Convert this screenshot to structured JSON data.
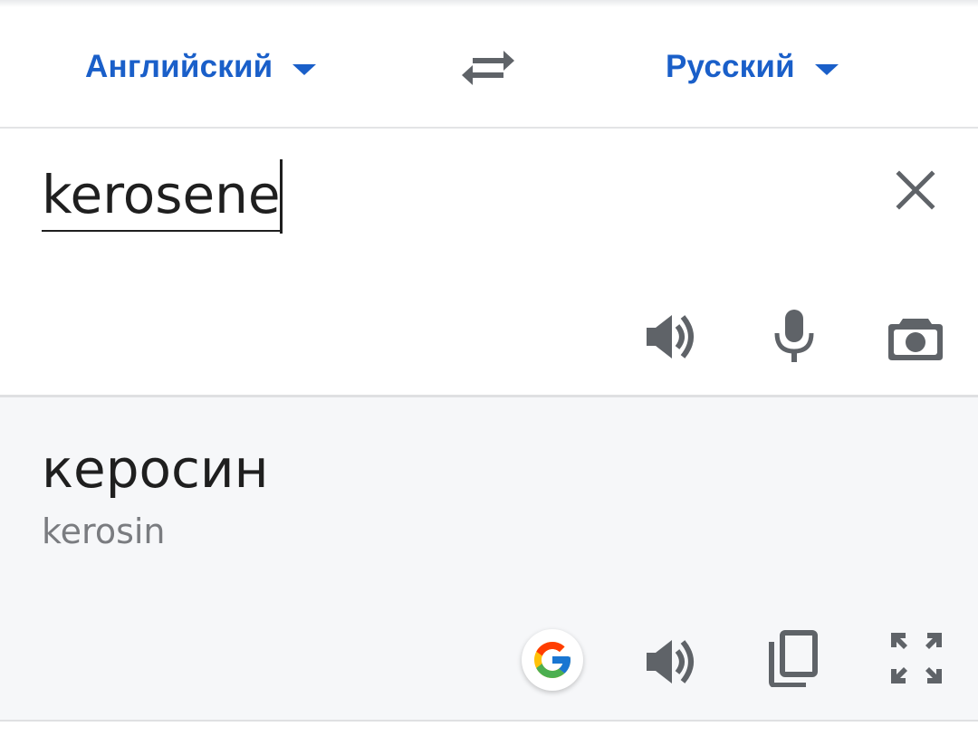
{
  "language_bar": {
    "source_language": "Английский",
    "target_language": "Русский",
    "swap_icon": "swap-arrows-icon",
    "dropdown_icon": "caret-down-icon"
  },
  "input": {
    "text": "kerosene",
    "clear_icon": "close-icon",
    "actions": [
      "speaker-icon",
      "microphone-icon",
      "camera-icon"
    ]
  },
  "output": {
    "translation": "керосин",
    "transliteration": "kerosin",
    "actions": [
      "google-icon",
      "speaker-icon",
      "copy-icon",
      "fullscreen-icon"
    ]
  },
  "colors": {
    "accent": "#1a5fc9",
    "icon": "#5f6368",
    "output_background": "#f6f7f9",
    "transliteration": "#7a7c80"
  }
}
